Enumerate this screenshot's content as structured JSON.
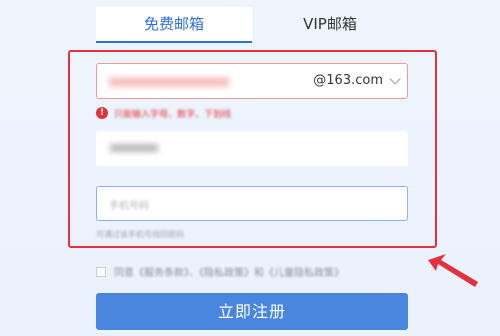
{
  "tabs": [
    {
      "label": "免费邮箱"
    },
    {
      "label": "VIP邮箱"
    }
  ],
  "email": {
    "domain": "@163.com"
  },
  "error": {
    "message": "只能输入字母、数字、下划线"
  },
  "phone": {
    "placeholder": "手机号码"
  },
  "hint": "可通过该手机号找回密码",
  "agreement": "同意《服务条款》、《隐私政策》和《儿童隐私政策》",
  "register_label": "立即注册",
  "colors": {
    "accent": "#2f6fd6",
    "button": "#4a86dd",
    "error": "#e5313b"
  }
}
